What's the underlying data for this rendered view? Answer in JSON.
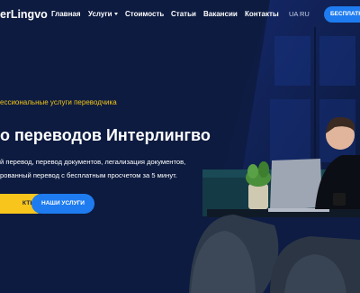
{
  "header": {
    "logo": "erLingvo",
    "nav": {
      "home": "Главная",
      "services": "Услуги",
      "pricing": "Стоимость",
      "articles": "Статьи",
      "jobs": "Вакансии",
      "contacts": "Контакты"
    },
    "languages": {
      "ua": "UA",
      "ru": "RU"
    },
    "cta_label": "БЕСПЛАТН"
  },
  "hero": {
    "subtitle": "ессиональные услуги переводчика",
    "title": "о переводов Интерлингво",
    "description": [
      "й перевод, перевод документов, легализация документов,",
      "рованный перевод с бесплатным просчетом за 5 минут."
    ],
    "buttons": {
      "contacts": "КТЫ",
      "services": "НАШИ УСЛУГИ"
    }
  },
  "colors": {
    "background": "#0d1e45",
    "accent_blue": "#1e7cf0",
    "accent_yellow": "#f7c51c",
    "subtitle_yellow": "#f2c516"
  }
}
